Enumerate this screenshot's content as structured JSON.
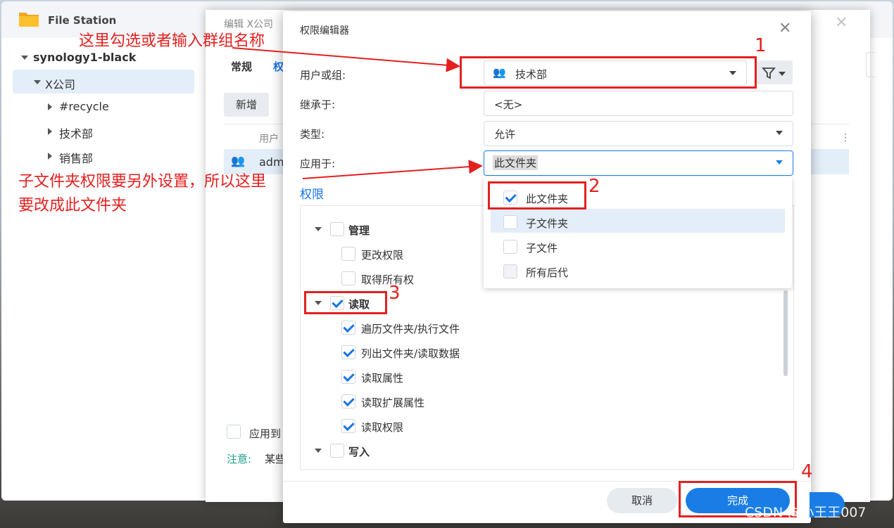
{
  "file_station": {
    "title": "File Station",
    "tree": {
      "root": "synology1-black",
      "selected": "X公司",
      "children": [
        "#recycle",
        "技术部",
        "销售部"
      ]
    }
  },
  "edit_dialog": {
    "title": "编辑 X公司 ",
    "tabs": [
      "常规",
      "权"
    ],
    "add_button": "新增",
    "column_user": "用户",
    "row_user": "adm",
    "apply_checkbox_label": "应用到",
    "note_label": "注意:",
    "note_text": "某些"
  },
  "permission_editor": {
    "title": "权限编辑器",
    "user_group_label": "用户或组:",
    "user_group_value": "技术部",
    "inherit_label": "继承于:",
    "inherit_value": "<无>",
    "type_label": "类型:",
    "type_value": "允许",
    "apply_label": "应用于:",
    "apply_value": "此文件夹",
    "permissions_title": "权限",
    "dropdown_options": [
      {
        "label": "此文件夹",
        "checked": true
      },
      {
        "label": "子文件夹",
        "checked": false
      },
      {
        "label": "子文件",
        "checked": false
      },
      {
        "label": "所有后代",
        "checked": false
      }
    ],
    "groups": {
      "manage": {
        "label": "管理",
        "items": [
          "更改权限",
          "取得所有权"
        ]
      },
      "read": {
        "label": "读取",
        "items": [
          "遍历文件夹/执行文件",
          "列出文件夹/读取数据",
          "读取属性",
          "读取扩展属性",
          "读取权限"
        ]
      },
      "write": {
        "label": "写入"
      }
    },
    "cancel_label": "取消",
    "done_label": "完成"
  },
  "annotations": {
    "note1": "这里勾选或者输入群组名称",
    "note2_line1": "子文件夹权限要另外设置，所以这里",
    "note2_line2": "要改成此文件夹",
    "n1": "1",
    "n2": "2",
    "n3": "3",
    "n4": "4"
  },
  "watermark": "CSDN @小王王007",
  "colors": {
    "accent": "#1a7de6",
    "annotation": "#e4201f"
  }
}
